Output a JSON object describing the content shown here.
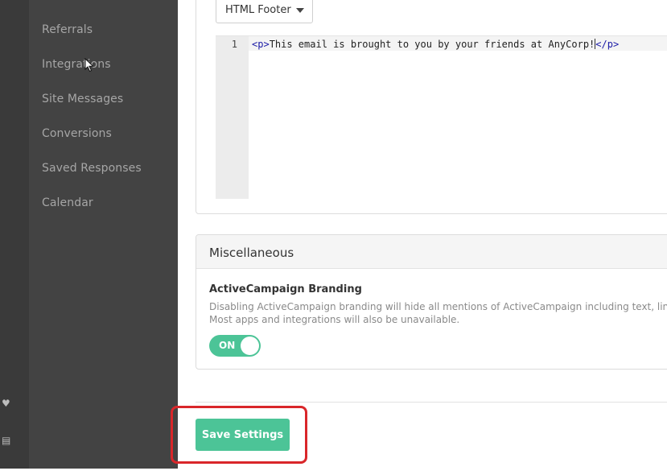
{
  "sidebar": {
    "items": [
      {
        "label": "Referrals"
      },
      {
        "label": "Integrations"
      },
      {
        "label": "Site Messages"
      },
      {
        "label": "Conversions"
      },
      {
        "label": "Saved Responses"
      },
      {
        "label": "Calendar"
      }
    ]
  },
  "footer_editor": {
    "dropdown_value": "HTML Footer",
    "line_number": "1",
    "code_open_tag": "<p>",
    "code_text": "This email is brought to you by your friends at AnyCorp!",
    "code_close_tag": "</p>"
  },
  "miscellaneous": {
    "title": "Miscellaneous",
    "branding_label": "ActiveCampaign Branding",
    "branding_desc_line1": "Disabling ActiveCampaign branding will hide all mentions of ActiveCampaign including text, links, and",
    "branding_desc_line2": "Most apps and integrations will also be unavailable.",
    "toggle_label": "ON"
  },
  "actions": {
    "save_label": "Save Settings"
  },
  "colors": {
    "accent": "#4cc497",
    "sidebar_bg": "#434343",
    "highlight": "#d9262a"
  },
  "icons": {
    "rail_top": "heart-icon",
    "rail_bottom": "clipboard-icon"
  }
}
